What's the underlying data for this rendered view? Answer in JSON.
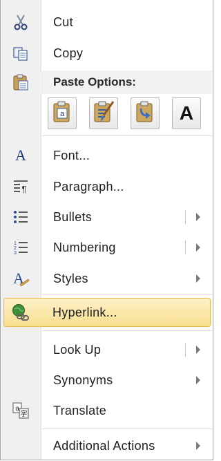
{
  "menu": {
    "items": [
      {
        "label": "Cut",
        "icon": "scissors-icon"
      },
      {
        "label": "Copy",
        "icon": "copy-icon"
      },
      {
        "label": "Font...",
        "icon": "font-icon"
      },
      {
        "label": "Paragraph...",
        "icon": "paragraph-icon"
      },
      {
        "label": "Bullets",
        "icon": "bullets-icon"
      },
      {
        "label": "Numbering",
        "icon": "numbering-icon"
      },
      {
        "label": "Styles",
        "icon": "styles-icon"
      },
      {
        "label": "Hyperlink...",
        "icon": "hyperlink-icon"
      },
      {
        "label": "Look Up",
        "icon": ""
      },
      {
        "label": "Synonyms",
        "icon": ""
      },
      {
        "label": "Translate",
        "icon": "translate-icon"
      },
      {
        "label": "Additional Actions",
        "icon": ""
      }
    ],
    "paste_header": "Paste Options:",
    "paste_options": [
      {
        "icon": "keep-source-formatting-icon"
      },
      {
        "icon": "merge-formatting-icon"
      },
      {
        "icon": "keep-text-only-arrow-icon"
      },
      {
        "icon": "keep-text-only-icon",
        "glyph": "A"
      }
    ],
    "colors": {
      "highlight_top": "#fcf0c6",
      "highlight_bottom": "#f8df8f",
      "highlight_border": "#e6b94e"
    }
  }
}
